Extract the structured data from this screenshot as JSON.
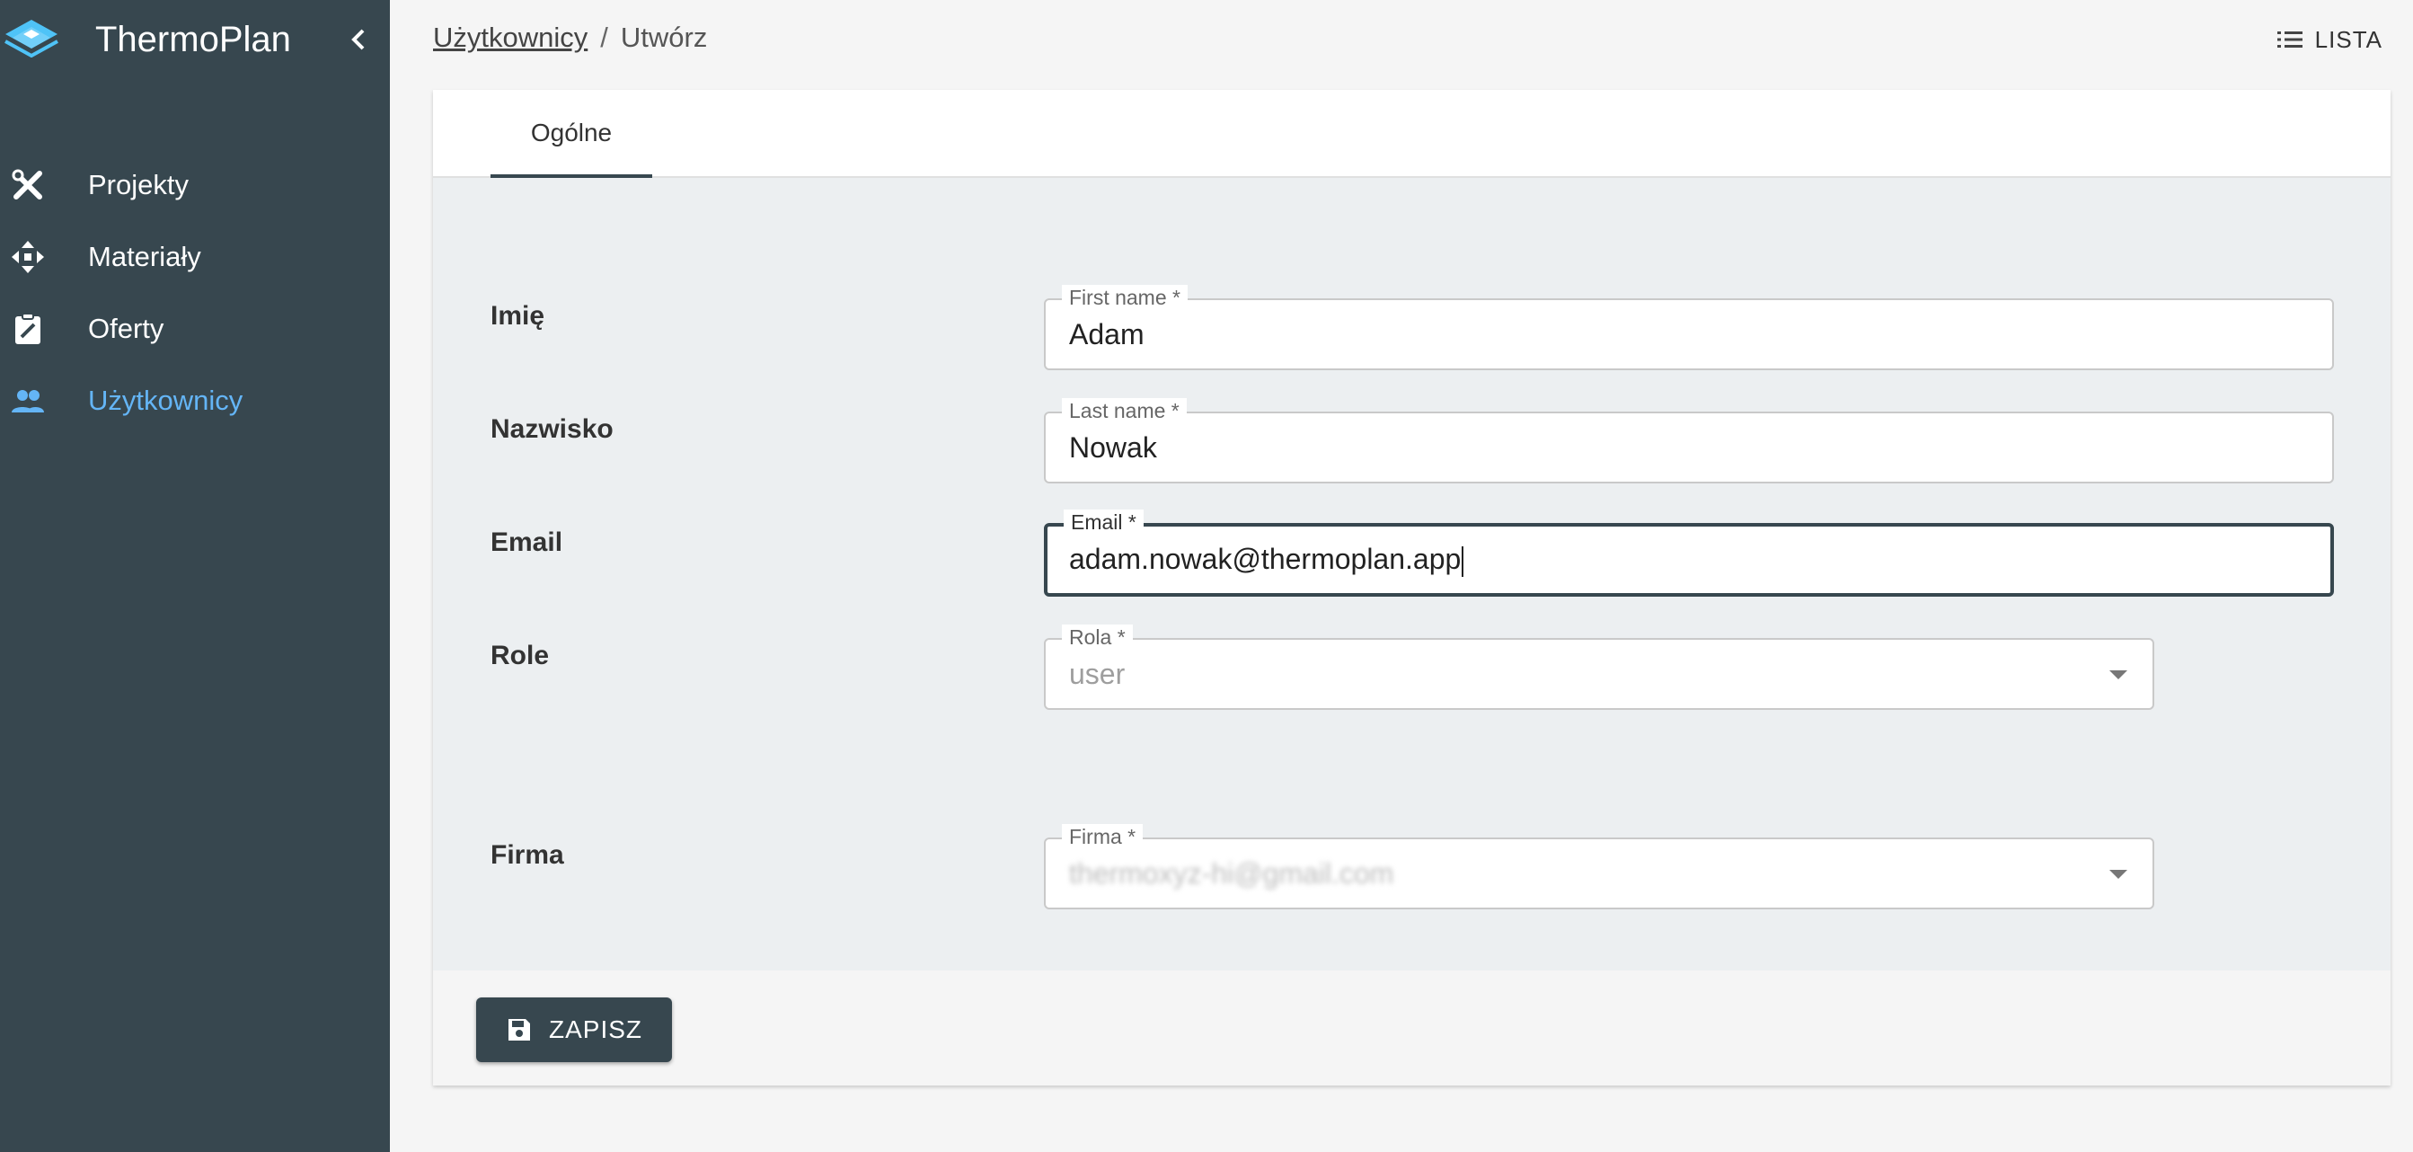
{
  "app": {
    "name": "ThermoPlan"
  },
  "sidebar": {
    "items": [
      {
        "label": "Projekty",
        "icon": "tools-icon"
      },
      {
        "label": "Materiały",
        "icon": "move-arrows-icon"
      },
      {
        "label": "Oferty",
        "icon": "clipboard-edit-icon"
      },
      {
        "label": "Użytkownicy",
        "icon": "people-icon",
        "active": true
      }
    ]
  },
  "breadcrumb": {
    "parent": "Użytkownicy",
    "separator": "/",
    "current": "Utwórz"
  },
  "header": {
    "list_label": "LISTA"
  },
  "tabs": [
    {
      "label": "Ogólne",
      "active": true
    }
  ],
  "form": {
    "first_name": {
      "label": "Imię",
      "legend": "First name *",
      "value": "Adam"
    },
    "last_name": {
      "label": "Nazwisko",
      "legend": "Last name *",
      "value": "Nowak"
    },
    "email": {
      "label": "Email",
      "legend": "Email *",
      "value": "adam.nowak@thermoplan.app"
    },
    "role": {
      "label": "Role",
      "legend": "Rola *",
      "value": "user"
    },
    "company": {
      "label": "Firma",
      "legend": "Firma *",
      "value": "thermoxyz-hi@gmail.com"
    }
  },
  "footer": {
    "save_label": "ZAPISZ"
  },
  "colors": {
    "sidebar": "#37474f",
    "accent": "#64b5f6",
    "form_bg": "#eceff1"
  }
}
